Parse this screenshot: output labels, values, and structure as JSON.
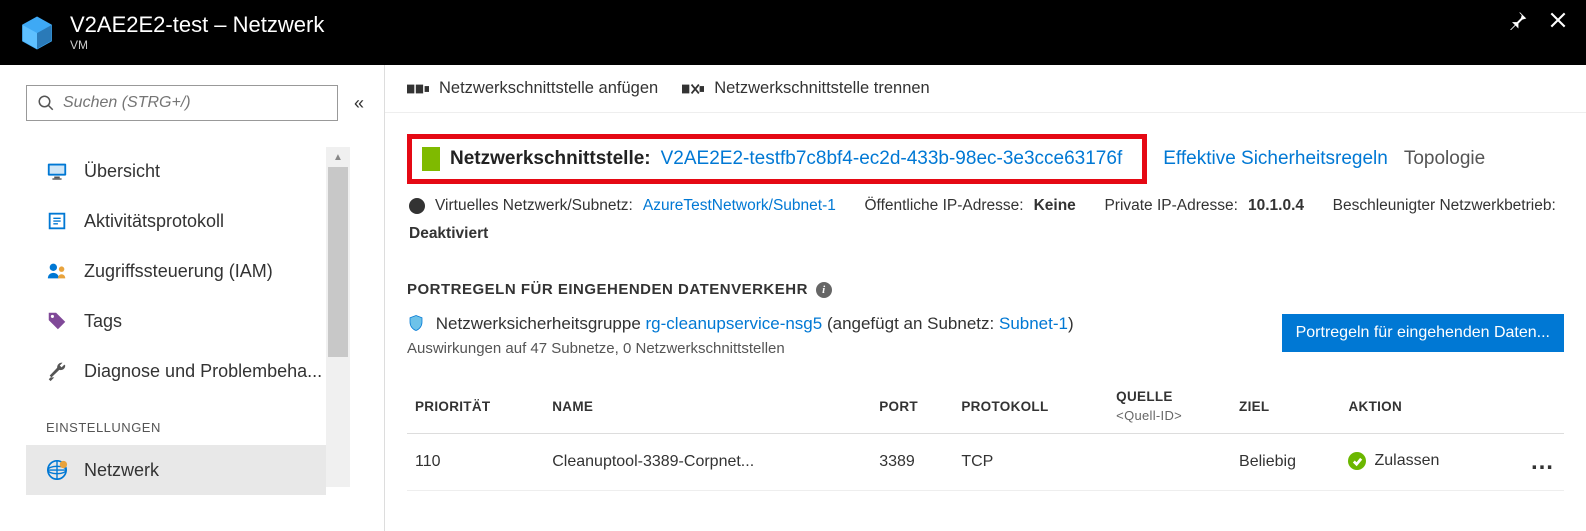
{
  "header": {
    "title": "V2AE2E2-test – Netzwerk",
    "subtitle": "VM"
  },
  "sidebar": {
    "search_placeholder": "Suchen (STRG+/)",
    "items": [
      {
        "label": "Übersicht"
      },
      {
        "label": "Aktivitätsprotokoll"
      },
      {
        "label": "Zugriffssteuerung (IAM)"
      },
      {
        "label": "Tags"
      },
      {
        "label": "Diagnose und Problembeha..."
      }
    ],
    "section_label": "EINSTELLUNGEN",
    "settings_items": [
      {
        "label": "Netzwerk"
      }
    ]
  },
  "toolbar": {
    "attach": "Netzwerkschnittstelle anfügen",
    "detach": "Netzwerkschnittstelle trennen"
  },
  "nic": {
    "label": "Netzwerkschnittstelle:",
    "value": "V2AE2E2-testfb7c8bf4-ec2d-433b-98ec-3e3cce63176f",
    "rules_link": "Effektive Sicherheitsregeln",
    "topology": "Topologie"
  },
  "info": {
    "vnet_label": "Virtuelles Netzwerk/Subnetz:",
    "vnet_value": "AzureTestNetwork/Subnet-1",
    "pubip_label": "Öffentliche IP-Adresse:",
    "pubip_value": "Keine",
    "privip_label": "Private IP-Adresse:",
    "privip_value": "10.1.0.4",
    "accel_label": "Beschleunigter Netzwerkbetrieb:",
    "accel_value": "Deaktiviert"
  },
  "rules": {
    "title": "PORTREGELN FÜR EINGEHENDEN DATENVERKEHR",
    "nsg_prefix": "Netzwerksicherheitsgruppe",
    "nsg_name": "rg-cleanupservice-nsg5",
    "nsg_mid": "(angefügt an Subnetz:",
    "nsg_subnet": "Subnet-1",
    "nsg_suffix": ")",
    "impact": "Auswirkungen auf 47 Subnetze, 0 Netzwerkschnittstellen",
    "add_button": "Portregeln für eingehenden Daten...",
    "headers": {
      "priority": "PRIORITÄT",
      "name": "NAME",
      "port": "PORT",
      "protocol": "PROTOKOLL",
      "source": "QUELLE",
      "source_sub": "<Quell-ID>",
      "dest": "ZIEL",
      "action": "AKTION"
    },
    "rows": [
      {
        "priority": "110",
        "name": "Cleanuptool-3389-Corpnet...",
        "port": "3389",
        "protocol": "TCP",
        "source": "",
        "dest": "Beliebig",
        "action": "Zulassen"
      }
    ]
  }
}
